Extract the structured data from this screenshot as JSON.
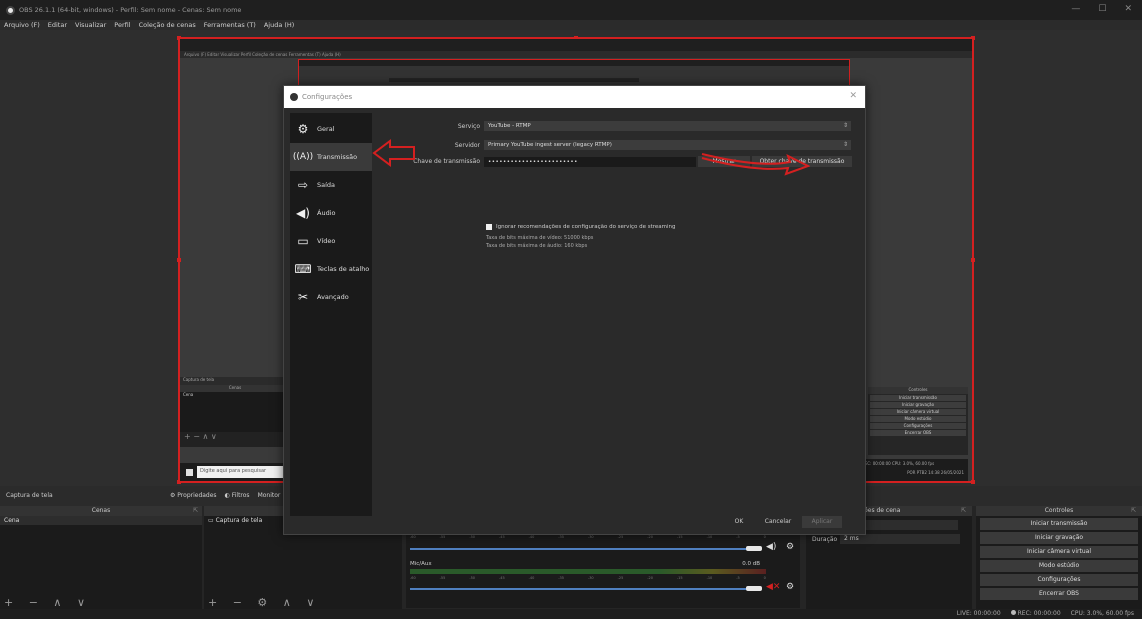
{
  "window": {
    "title": "OBS 26.1.1 (64-bit, windows) - Perfil: Sem nome - Cenas: Sem nome",
    "minimize": "—",
    "maximize": "☐",
    "close": "✕"
  },
  "menu": [
    "Arquivo (F)",
    "Editar",
    "Visualizar",
    "Perfil",
    "Coleção de cenas",
    "Ferramentas (T)",
    "Ajuda (H)"
  ],
  "preview_nested": {
    "menu_text": "Arquivo (F)   Editar   Visualizar   Perfil   Coleção de cenas   Ferramentas (T)   Ajuda (H)",
    "source_label": "Captura de tela",
    "scenes_header": "Cenas",
    "scene_item": "Cena",
    "taskbar_search": "Digite aqui para pesquisar",
    "controls_header": "Controles",
    "controls": [
      "Iniciar transmissão",
      "Iniciar gravação",
      "Iniciar câmera virtual",
      "Modo estúdio",
      "Configurações",
      "Encerrar OBS"
    ],
    "status_text": "REC: 00:00:00   CPU: 3.0%, 60.00 fps",
    "clock_text": "POR PTB2 14:38 26/05/2021"
  },
  "source_bar": {
    "label": "Captura de tela",
    "properties": "Propriedades",
    "filters": "Filtros",
    "monitor": "Monitor"
  },
  "docks": {
    "scenes_header": "Cenas",
    "scene_item": "Cena",
    "sources_item": "Captura de tela",
    "scenes_controls": "+ − ∧ ∨",
    "sources_controls": "+ − ⚙ ∧ ∨",
    "mixer_track2": "Mic/Aux",
    "mixer_track2_db": "0.0 dB",
    "transitions_header": "sições de cena",
    "duration_label": "Duração",
    "duration_value": "2 ms",
    "controls_header": "Controles",
    "controls": [
      "Iniciar transmissão",
      "Iniciar gravação",
      "Iniciar câmera virtual",
      "Modo estúdio",
      "Configurações",
      "Encerrar OBS"
    ]
  },
  "statusbar": {
    "live": "LIVE: 00:00:00",
    "rec": "REC: 00:00:00",
    "cpu": "CPU: 3.0%, 60.00 fps"
  },
  "dialog": {
    "title": "Configurações",
    "close": "✕",
    "nav": [
      {
        "label": "Geral",
        "icon": "gear-icon"
      },
      {
        "label": "Transmissão",
        "icon": "broadcast-icon"
      },
      {
        "label": "Saída",
        "icon": "output-icon"
      },
      {
        "label": "Áudio",
        "icon": "speaker-icon"
      },
      {
        "label": "Vídeo",
        "icon": "monitor-icon"
      },
      {
        "label": "Teclas de atalho",
        "icon": "keyboard-icon"
      },
      {
        "label": "Avançado",
        "icon": "tools-icon"
      }
    ],
    "service_label": "Serviço",
    "service_value": "YouTube - RTMP",
    "server_label": "Servidor",
    "server_value": "Primary YouTube ingest server (legacy RTMP)",
    "key_label": "Chave de transmissão",
    "key_value": "••••••••••••••••••••••••",
    "show_button": "Mostrar",
    "get_key_button": "Obter chave de transmissão",
    "ignore_label": "Ignorar recomendações de configuração do serviço de streaming",
    "max_video": "Taxa de bits máxima de vídeo: 51000 kbps",
    "max_audio": "Taxa de bits máxima de áudio: 160 kbps",
    "ok": "OK",
    "cancel": "Cancelar",
    "apply": "Aplicar"
  },
  "colors": {
    "accent_red": "#d42020",
    "bg_dark": "#1e1e1e",
    "dialog_bg": "#2a2a2a"
  }
}
